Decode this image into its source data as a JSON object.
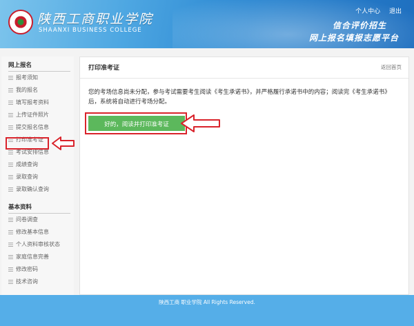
{
  "header": {
    "school_name_cn": "陕西工商职业学院",
    "school_name_en": "SHAANXI BUSINESS COLLEGE",
    "links": [
      "个人中心",
      "退出"
    ],
    "slogan_line1": "信合评价招生",
    "slogan_line2": "网上报名填报志愿平台"
  },
  "sidebar": {
    "section1_title": "网上报名",
    "section1_items": [
      "报考须知",
      "我的报名",
      "填写报考资料",
      "上传证件照片",
      "提交报名信息",
      "打印准考证",
      "考试安排信息",
      "成绩查询",
      "录取查询",
      "录取确认查询"
    ],
    "section2_title": "基本资料",
    "section2_items": [
      "问卷调查",
      "修改基本信息",
      "个人资料审核状态",
      "家庭信息完善",
      "修改密码",
      "技术咨询"
    ]
  },
  "main": {
    "title": "打印准考证",
    "back_home": "返回首页",
    "notice": "您的考场信息尚未分配，参与考试需要考生阅读《考生承诺书》，并严格履行承诺书中的内容；阅读完《考生承诺书》后，系统将自动进行考场分配。",
    "confirm_button": "好的，阅读并打印准考证"
  },
  "footer": {
    "copyright": "陕西工商 职业学院 All Rights Reserved."
  },
  "colors": {
    "accent_red": "#d9222a",
    "button_green": "#5cb85c",
    "footer_blue": "#55aee8"
  }
}
